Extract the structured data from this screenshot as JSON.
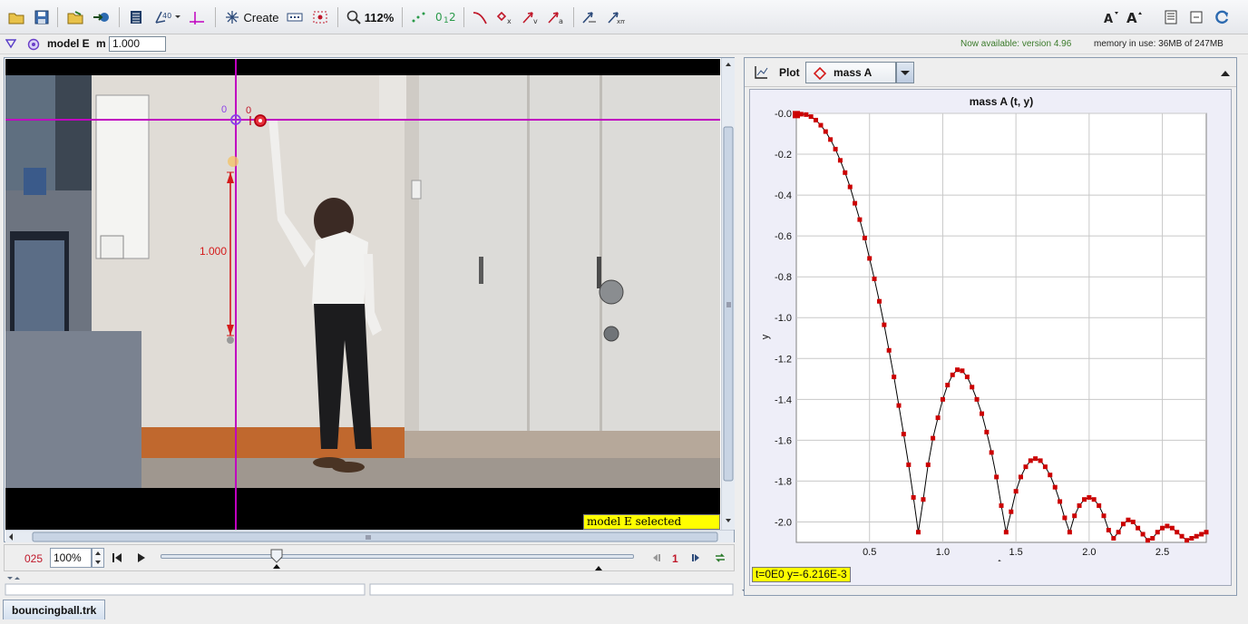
{
  "toolbar": {
    "create_label": "Create",
    "zoom_label": "112%",
    "colors": {
      "accent": "#2c4a7a",
      "red": "#c0182a",
      "green": "#2a9a4a"
    }
  },
  "track_bar": {
    "track_name": "model E",
    "mass_label": "m",
    "mass_value": "1.000",
    "notice": "Now available: version 4.96",
    "memory": "memory in use: 36MB of 247MB"
  },
  "video": {
    "origin_label": "0",
    "axis_label": "0",
    "calibration_length": "1.000",
    "selected_status": "model E selected (locked)",
    "colors": {
      "axes": "#c000c0",
      "calibration": "#d41a1a",
      "origin": "#8a3ee8"
    }
  },
  "player": {
    "frame_number": "025",
    "zoom": "100%",
    "step_size": "1"
  },
  "file_tab": "bouncingball.trk",
  "plot": {
    "plot_label": "Plot",
    "track_choice": "mass A",
    "readout": "t=0E0  y=-6.216E-3"
  },
  "chart_data": {
    "type": "scatter",
    "title": "mass A (t, y)",
    "xlabel": "t",
    "ylabel": "y",
    "xlim": [
      0,
      2.8
    ],
    "ylim": [
      -2.1,
      0.0
    ],
    "xticks": [
      "0.5",
      "1.0",
      "1.5",
      "2.0",
      "2.5"
    ],
    "yticks": [
      "-0.0",
      "-0.2",
      "-0.4",
      "-0.6",
      "-0.8",
      "-1.0",
      "-1.2",
      "-1.4",
      "-1.6",
      "-1.8",
      "-2.0"
    ],
    "grid": true,
    "series": [
      {
        "marker_color": "#cc0000",
        "line_color": "#000000",
        "x": [
          0.0,
          0.033,
          0.067,
          0.1,
          0.133,
          0.167,
          0.2,
          0.233,
          0.267,
          0.3,
          0.333,
          0.367,
          0.4,
          0.433,
          0.467,
          0.5,
          0.533,
          0.567,
          0.6,
          0.633,
          0.667,
          0.7,
          0.733,
          0.767,
          0.8,
          0.833,
          0.867,
          0.9,
          0.933,
          0.967,
          1.0,
          1.033,
          1.067,
          1.1,
          1.133,
          1.167,
          1.2,
          1.233,
          1.267,
          1.3,
          1.333,
          1.367,
          1.4,
          1.433,
          1.467,
          1.5,
          1.533,
          1.567,
          1.6,
          1.633,
          1.667,
          1.7,
          1.733,
          1.767,
          1.8,
          1.833,
          1.867,
          1.9,
          1.933,
          1.967,
          2.0,
          2.033,
          2.067,
          2.1,
          2.133,
          2.167,
          2.2,
          2.233,
          2.267,
          2.3,
          2.333,
          2.367,
          2.4,
          2.433,
          2.467,
          2.5,
          2.533,
          2.567,
          2.6,
          2.633,
          2.667,
          2.7,
          2.733,
          2.767,
          2.8
        ],
        "y": [
          -0.006,
          -0.004,
          -0.006,
          -0.016,
          -0.033,
          -0.058,
          -0.089,
          -0.128,
          -0.175,
          -0.23,
          -0.29,
          -0.36,
          -0.44,
          -0.52,
          -0.61,
          -0.71,
          -0.81,
          -0.92,
          -1.035,
          -1.16,
          -1.29,
          -1.43,
          -1.57,
          -1.72,
          -1.88,
          -2.05,
          -1.89,
          -1.72,
          -1.59,
          -1.49,
          -1.4,
          -1.33,
          -1.28,
          -1.255,
          -1.26,
          -1.29,
          -1.34,
          -1.4,
          -1.47,
          -1.56,
          -1.66,
          -1.78,
          -1.92,
          -2.05,
          -1.95,
          -1.85,
          -1.78,
          -1.73,
          -1.7,
          -1.69,
          -1.7,
          -1.73,
          -1.77,
          -1.83,
          -1.9,
          -1.98,
          -2.05,
          -1.97,
          -1.92,
          -1.89,
          -1.88,
          -1.89,
          -1.92,
          -1.97,
          -2.04,
          -2.08,
          -2.05,
          -2.01,
          -1.99,
          -2.0,
          -2.03,
          -2.06,
          -2.09,
          -2.08,
          -2.05,
          -2.03,
          -2.02,
          -2.03,
          -2.05,
          -2.07,
          -2.09,
          -2.08,
          -2.07,
          -2.06,
          -2.05
        ]
      }
    ]
  }
}
